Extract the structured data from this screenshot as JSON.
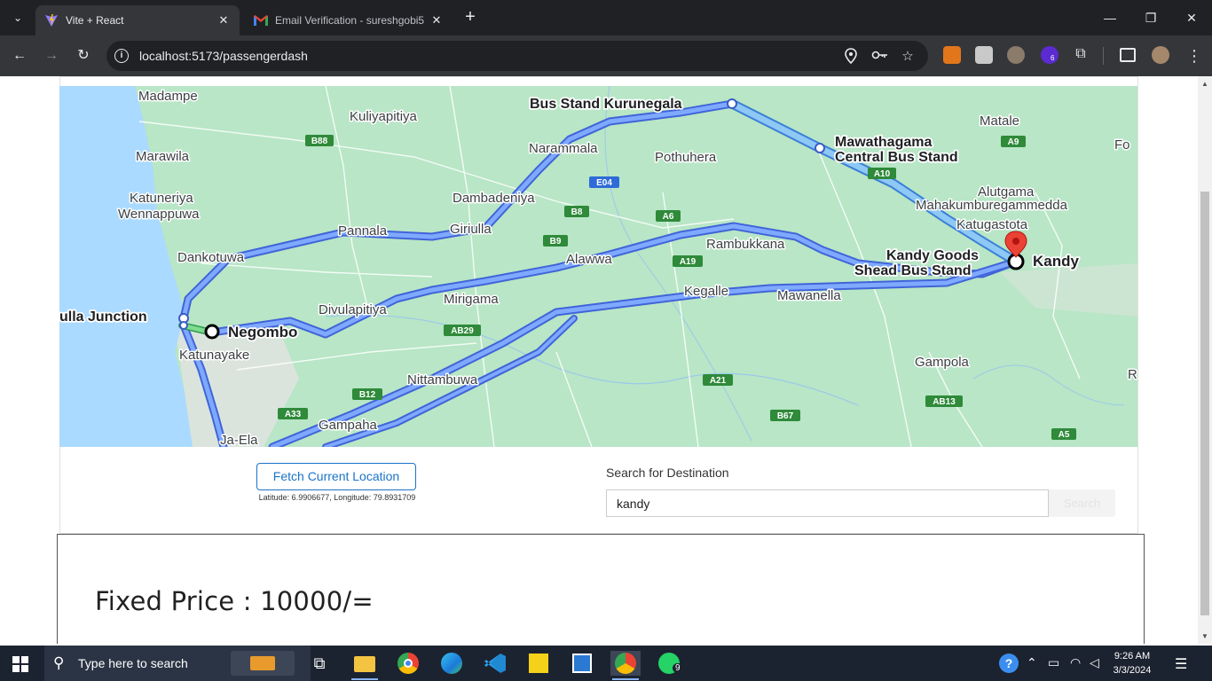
{
  "browser": {
    "tabs": [
      {
        "title": "Vite + React",
        "active": true
      },
      {
        "title": "Email Verification - sureshgobi5",
        "active": false
      }
    ],
    "url": "localhost:5173/passengerdash",
    "extension_badge": "6"
  },
  "map": {
    "labels": {
      "madampe": "Madampe",
      "kuliyapitiya": "Kuliyapitiya",
      "bus_stand_kurunegala": "Bus Stand Kurunegala",
      "matale": "Matale",
      "marawila": "Marawila",
      "narammala": "Narammala",
      "pothuhera": "Pothuhera",
      "mawathagama": "Mawathagama",
      "central_bus_stand": "Central Bus Stand",
      "katuneriya": "Katuneriya",
      "wennappuwa": "Wennappuwa",
      "dambadeniya": "Dambadeniya",
      "alutgama": "Alutgama",
      "mahakumburegammedda": "Mahakumburegammedda",
      "katugastota": "Katugastota",
      "pannala": "Pannala",
      "giriulla": "Giriulla",
      "rambukkana": "Rambukkana",
      "dankotuwa": "Dankotuwa",
      "alawwa": "Alawwa",
      "kandy_goods": "Kandy Goods",
      "shead_bus_stand": "Shead Bus Stand",
      "kandy": "Kandy",
      "kegalle": "Kegalle",
      "mawanella": "Mawanella",
      "ulla_junction": "ulla Junction",
      "divulapitiya": "Divulapitiya",
      "mirigama": "Mirigama",
      "negombo": "Negombo",
      "katunayake": "Katunayake",
      "gampola": "Gampola",
      "nittambuwa": "Nittambuwa",
      "gampaha": "Gampaha",
      "ja_ela": "Ja-Ela",
      "fo": "Fo",
      "r": "R"
    },
    "road_shields": {
      "b88": "B88",
      "a9": "A9",
      "e04": "E04",
      "a10": "A10",
      "b8": "B8",
      "a6": "A6",
      "b9": "B9",
      "a19": "A19",
      "ab29": "AB29",
      "b12": "B12",
      "a21": "A21",
      "a33": "A33",
      "b67": "B67",
      "ab13": "AB13",
      "a5": "A5"
    },
    "colors": {
      "water": "#aadaff",
      "land": "#b7e7c7",
      "route": "#6b8cf0",
      "route_outline": "#3b5cc8",
      "main_route": "#8ec8f5",
      "pin": "#ea4335"
    }
  },
  "controls": {
    "fetch_button": "Fetch Current Location",
    "coordinates": "Latitude: 6.9906677, Longitude: 79.8931709",
    "search_label": "Search for Destination",
    "search_value": "kandy",
    "search_button": "Search"
  },
  "pricing": {
    "fixed_price": "Fixed Price : 10000/="
  },
  "taskbar": {
    "search_placeholder": "Type here to search",
    "time": "9:26 AM",
    "date": "3/3/2024",
    "whatsapp_badge": "9"
  }
}
